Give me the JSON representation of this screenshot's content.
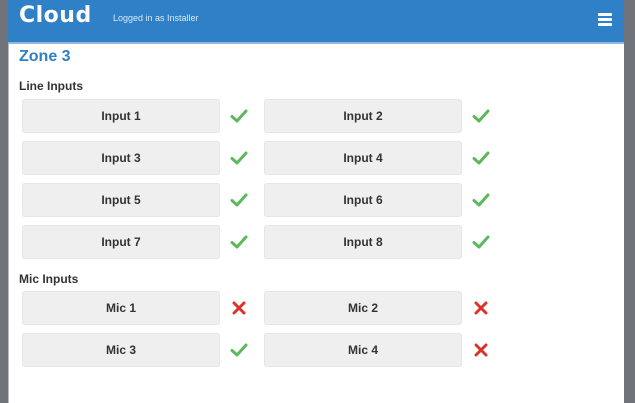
{
  "header": {
    "logo": "Cloud",
    "login_text": "Logged in as Installer",
    "menu_icon": "hamburger-menu-icon"
  },
  "zone": {
    "title": "Zone 3"
  },
  "line_inputs": {
    "heading": "Line Inputs",
    "items": [
      {
        "label": "Input 1",
        "status": "ok"
      },
      {
        "label": "Input 2",
        "status": "ok"
      },
      {
        "label": "Input 3",
        "status": "ok"
      },
      {
        "label": "Input 4",
        "status": "ok"
      },
      {
        "label": "Input 5",
        "status": "ok"
      },
      {
        "label": "Input 6",
        "status": "ok"
      },
      {
        "label": "Input 7",
        "status": "ok"
      },
      {
        "label": "Input 8",
        "status": "ok"
      }
    ]
  },
  "mic_inputs": {
    "heading": "Mic Inputs",
    "items": [
      {
        "label": "Mic 1",
        "status": "error"
      },
      {
        "label": "Mic 2",
        "status": "error"
      },
      {
        "label": "Mic 3",
        "status": "ok"
      },
      {
        "label": "Mic 4",
        "status": "error"
      }
    ]
  },
  "colors": {
    "accent": "#2f80c6",
    "ok": "#5cb85c",
    "error": "#d9342b"
  }
}
